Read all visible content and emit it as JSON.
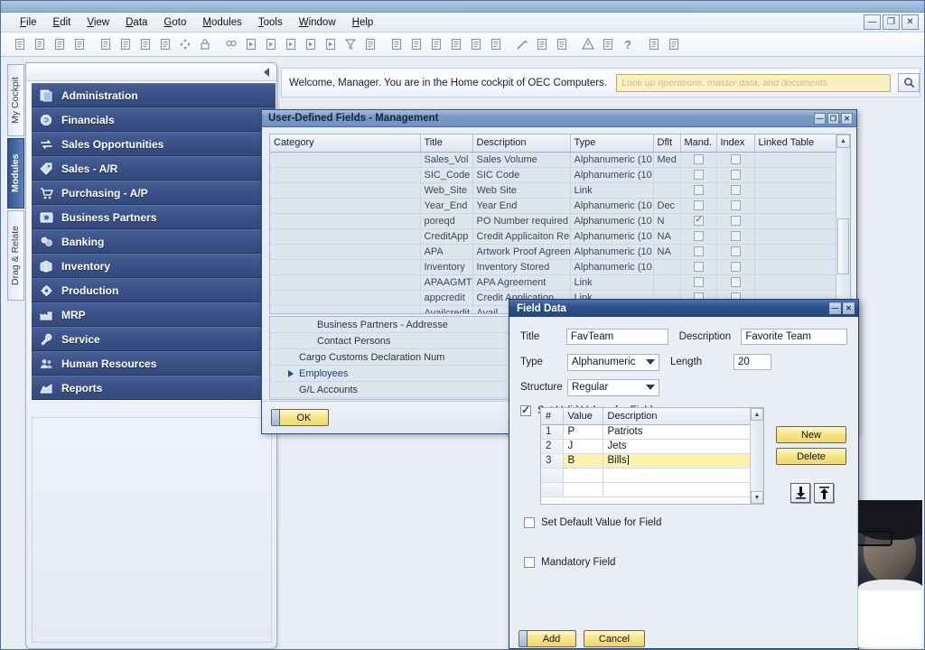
{
  "app": {
    "menu": [
      "File",
      "Edit",
      "View",
      "Data",
      "Goto",
      "Modules",
      "Tools",
      "Window",
      "Help"
    ],
    "window_controls": [
      "minimize",
      "restore",
      "close"
    ],
    "colors": {
      "module_blue": "#3b5288",
      "title_blue": "#2d4f89",
      "sap_yellow": "#f6e489",
      "edit_yellow": "#fbf2ae",
      "search_yellow": "#fbf0bf"
    }
  },
  "vtabs": [
    {
      "label": "My Cockpit",
      "selected": false
    },
    {
      "label": "Modules",
      "selected": true
    },
    {
      "label": "Drag & Relate",
      "selected": false
    }
  ],
  "modules": {
    "items": [
      {
        "label": "Administration",
        "icon": "document-stack-icon"
      },
      {
        "label": "Financials",
        "icon": "coin-icon"
      },
      {
        "label": "Sales Opportunities",
        "icon": "exchange-arrows-icon"
      },
      {
        "label": "Sales - A/R",
        "icon": "tag-icon"
      },
      {
        "label": "Purchasing - A/P",
        "icon": "shopping-cart-icon"
      },
      {
        "label": "Business Partners",
        "icon": "contacts-icon"
      },
      {
        "label": "Banking",
        "icon": "bank-icon"
      },
      {
        "label": "Inventory",
        "icon": "box-icon"
      },
      {
        "label": "Production",
        "icon": "gear-icon"
      },
      {
        "label": "MRP",
        "icon": "factory-icon"
      },
      {
        "label": "Service",
        "icon": "wrench-icon"
      },
      {
        "label": "Human Resources",
        "icon": "people-icon"
      },
      {
        "label": "Reports",
        "icon": "chart-icon"
      }
    ]
  },
  "welcome": {
    "text": "Welcome, Manager. You are in the Home cockpit of OEC Computers.",
    "search_placeholder": "Look up operations, master data, and documents",
    "search_value": "",
    "search_icon": "magnifier-icon"
  },
  "udf_window": {
    "title": "User-Defined Fields - Management",
    "ok_label": "OK",
    "columns": [
      "Category",
      "Title",
      "Description",
      "Type",
      "Dflt",
      "Mand.",
      "Index",
      "Linked Table"
    ],
    "rows": [
      {
        "category": "",
        "title": "Sales_Vol",
        "description": "Sales Volume",
        "type": "Alphanumeric (10",
        "dflt": "Med",
        "mand": false,
        "index": false,
        "linked": ""
      },
      {
        "category": "",
        "title": "SIC_Code",
        "description": "SIC Code",
        "type": "Alphanumeric (10",
        "dflt": "",
        "mand": false,
        "index": false,
        "linked": ""
      },
      {
        "category": "",
        "title": "Web_Site",
        "description": "Web Site",
        "type": "Link",
        "dflt": "",
        "mand": false,
        "index": false,
        "linked": ""
      },
      {
        "category": "",
        "title": "Year_End",
        "description": "Year End",
        "type": "Alphanumeric (10",
        "dflt": "Dec",
        "mand": false,
        "index": false,
        "linked": ""
      },
      {
        "category": "",
        "title": "poreqd",
        "description": "PO Number required",
        "type": "Alphanumeric (10",
        "dflt": "N",
        "mand": true,
        "index": false,
        "linked": ""
      },
      {
        "category": "",
        "title": "CreditApp",
        "description": "Credit Applicaiton Rec",
        "type": "Alphanumeric (10",
        "dflt": "NA",
        "mand": false,
        "index": false,
        "linked": ""
      },
      {
        "category": "",
        "title": "APA",
        "description": "Artwork Proof Agreem",
        "type": "Alphanumeric (10",
        "dflt": "NA",
        "mand": false,
        "index": false,
        "linked": ""
      },
      {
        "category": "",
        "title": "Inventory",
        "description": "Inventory Stored",
        "type": "Alphanumeric (10",
        "dflt": "",
        "mand": false,
        "index": false,
        "linked": ""
      },
      {
        "category": "",
        "title": "APAAGMT",
        "description": "APA Agreement",
        "type": "Link",
        "dflt": "",
        "mand": false,
        "index": false,
        "linked": ""
      },
      {
        "category": "",
        "title": "appcredit",
        "description": "Credit Application",
        "type": "Link",
        "dflt": "",
        "mand": false,
        "index": false,
        "linked": ""
      },
      {
        "category": "",
        "title": "Availcredit",
        "description": "Avail",
        "type": "",
        "dflt": "",
        "mand": false,
        "index": false,
        "linked": ""
      }
    ],
    "categories": [
      {
        "label": "Business Partners - Addresse",
        "level": 2,
        "expandable": false,
        "selected": false
      },
      {
        "label": "Contact Persons",
        "level": 2,
        "expandable": false,
        "selected": false
      },
      {
        "label": "Cargo Customs Declaration Num",
        "level": 1,
        "expandable": false,
        "selected": false
      },
      {
        "label": "Employees",
        "level": 1,
        "expandable": true,
        "selected": true
      },
      {
        "label": "G/L Accounts",
        "level": 1,
        "expandable": false,
        "selected": false
      }
    ]
  },
  "field_data": {
    "title": "Field Data",
    "title_label": "Title",
    "title_value": "FavTeam",
    "description_label": "Description",
    "description_value": "Favorite Team",
    "type_label": "Type",
    "type_value": "Alphanumeric",
    "length_label": "Length",
    "length_value": "20",
    "structure_label": "Structure",
    "structure_value": "Regular",
    "set_valid_values_label": "Set Valid Values for Field",
    "set_valid_values_checked": true,
    "set_default_label": "Set Default Value for Field",
    "set_default_checked": false,
    "mandatory_label": "Mandatory Field",
    "mandatory_checked": false,
    "vv_columns": [
      "#",
      "Value",
      "Description"
    ],
    "vv_rows": [
      {
        "n": "1",
        "value": "P",
        "description": "Patriots",
        "editing": false
      },
      {
        "n": "2",
        "value": "J",
        "description": "Jets",
        "editing": false
      },
      {
        "n": "3",
        "value": "B",
        "description": "Bills",
        "editing": true
      },
      {
        "n": "",
        "value": "",
        "description": "",
        "editing": false
      },
      {
        "n": "",
        "value": "",
        "description": "",
        "editing": false
      }
    ],
    "new_label": "New",
    "delete_label": "Delete",
    "add_label": "Add",
    "cancel_label": "Cancel",
    "move_down_icon": "arrow-down-icon",
    "move_up_icon": "arrow-up-icon"
  }
}
